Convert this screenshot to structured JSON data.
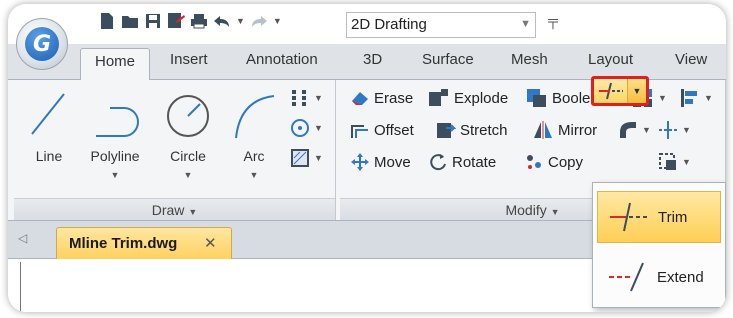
{
  "quick_access": {
    "workspace_value": "2D Drafting",
    "icons": [
      "new-icon",
      "open-icon",
      "save-icon",
      "saveas-icon",
      "print-icon",
      "undo-icon",
      "redo-icon"
    ]
  },
  "app_button": {
    "logo_letter": "G"
  },
  "tabs": [
    {
      "label": "Home",
      "active": true
    },
    {
      "label": "Insert"
    },
    {
      "label": "Annotation"
    },
    {
      "label": "3D"
    },
    {
      "label": "Surface"
    },
    {
      "label": "Mesh"
    },
    {
      "label": "Layout"
    },
    {
      "label": "View"
    }
  ],
  "draw_panel": {
    "title": "Draw",
    "tools": [
      "Line",
      "Polyline",
      "Circle",
      "Arc"
    ]
  },
  "modify_panel": {
    "title": "Modify",
    "rows": [
      [
        "Erase",
        "Explode",
        "Boolean"
      ],
      [
        "Offset",
        "Stretch",
        "Mirror"
      ],
      [
        "Move",
        "Rotate",
        "Copy"
      ]
    ]
  },
  "document": {
    "tab_name": "Mline Trim.dwg"
  },
  "dropdown": {
    "items": [
      {
        "label": "Trim",
        "highlighted": true
      },
      {
        "label": "Extend"
      }
    ]
  },
  "colors": {
    "accent_highlight": "#ffd565",
    "callout_border": "#e02020",
    "icon_blue": "#2f78c8",
    "icon_red": "#e0262a"
  }
}
